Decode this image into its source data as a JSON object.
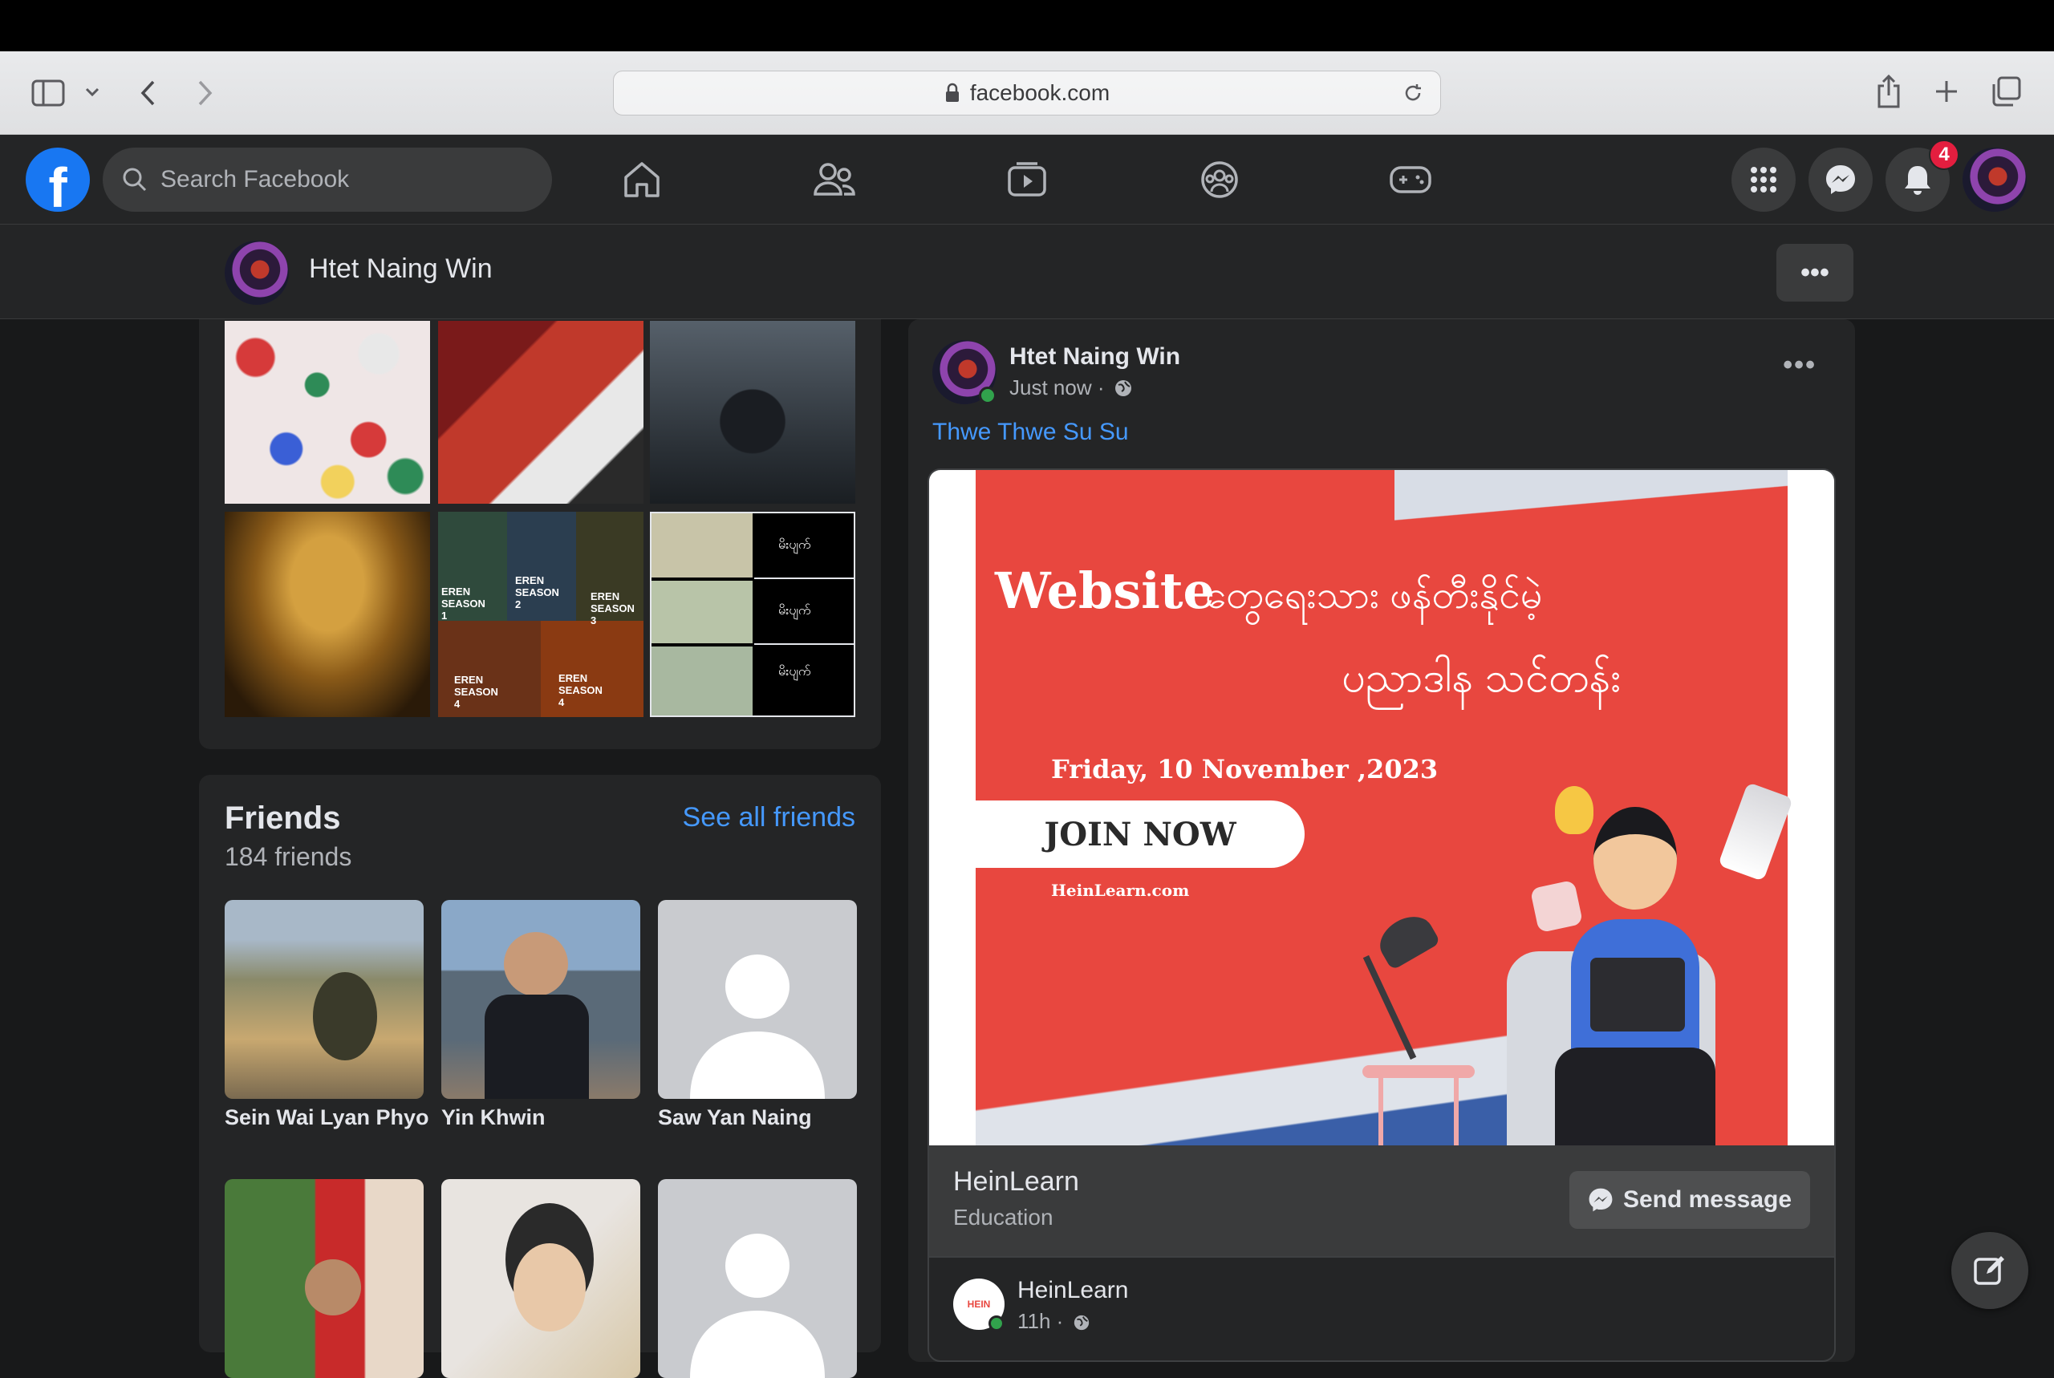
{
  "browser": {
    "url": "facebook.com"
  },
  "header": {
    "logo_letter": "f",
    "search_placeholder": "Search Facebook",
    "notification_count": "4"
  },
  "profile_bar": {
    "name": "Htet Naing Win",
    "more_label": "•••"
  },
  "photos": {
    "tiles": [
      {
        "caption": ""
      },
      {
        "caption": ""
      },
      {
        "caption": ""
      },
      {
        "caption": ""
      },
      {
        "captions": [
          "EREN SEASON 1",
          "EREN SEASON 2",
          "EREN SEASON 3",
          "EREN SEASON 4",
          "EREN SEASON 4"
        ]
      },
      {
        "captions": [
          "မိးပျက်",
          "မိးပျက်",
          "မိးပျက်"
        ]
      }
    ]
  },
  "friends": {
    "title": "Friends",
    "count": "184 friends",
    "see_all": "See all friends",
    "items": [
      {
        "name": "Sein Wai Lyan Phyo"
      },
      {
        "name": "Yin Khwin"
      },
      {
        "name": "Saw Yan Naing"
      },
      {
        "name": ""
      },
      {
        "name": ""
      },
      {
        "name": ""
      }
    ]
  },
  "post": {
    "author": "Htet Naing Win",
    "time": "Just now ·",
    "more": "•••",
    "tag": "Thwe Thwe Su Su",
    "ad": {
      "headline_en": "Website",
      "headline_my_1": "တွေရေးသား ဖန်တီးနိုင်မဲ့",
      "headline_my_2": "ပညာဒါန သင်တန်း",
      "date": "Friday, 10 November ,2023",
      "cta": "JOIN NOW",
      "site": "HeinLearn.com",
      "colors": {
        "bg": "#e8473f",
        "white": "#ffffff"
      }
    },
    "advertiser": "HeinLearn",
    "advertiser_category": "Education",
    "send_message": "Send message",
    "sub_post": {
      "author": "HeinLearn",
      "time": "11h ·"
    }
  }
}
